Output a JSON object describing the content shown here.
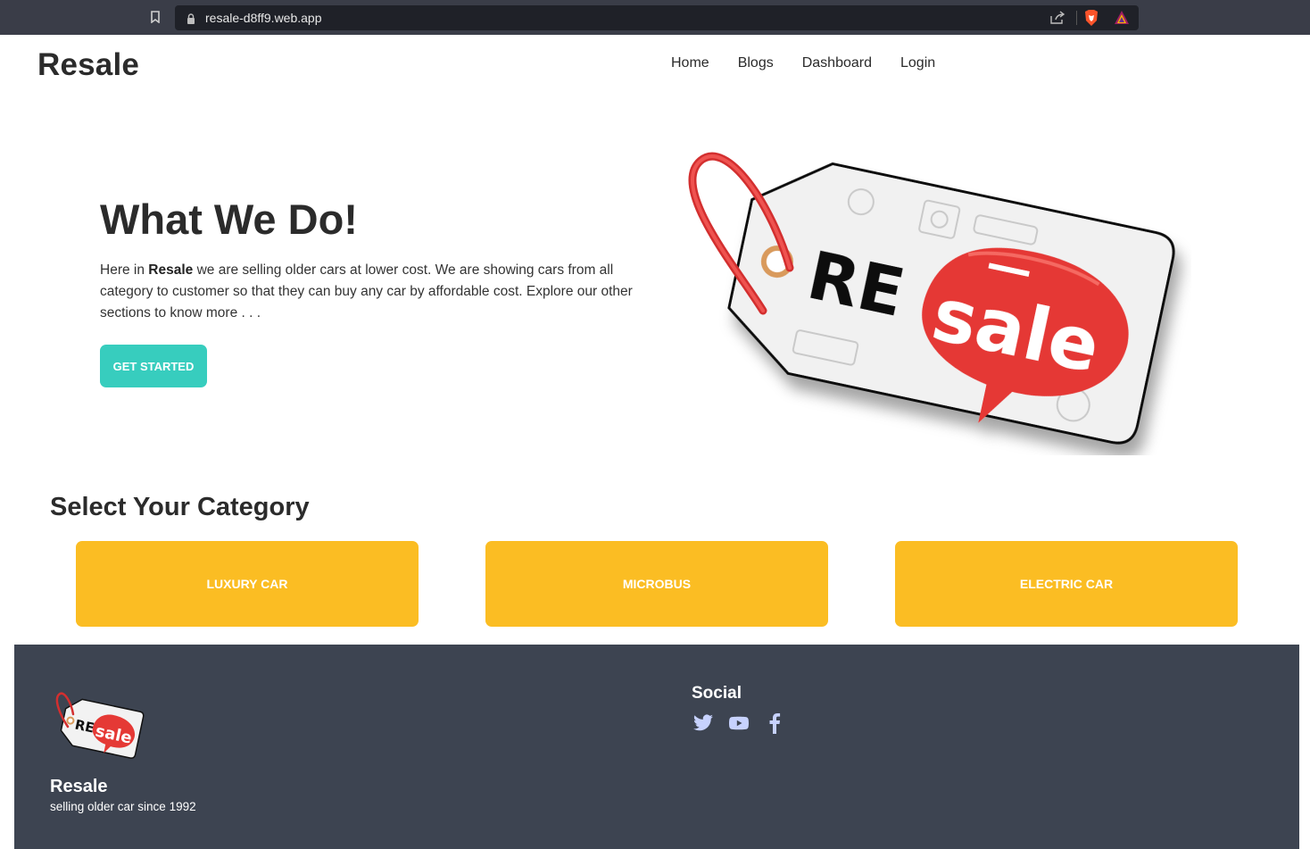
{
  "browser": {
    "url": "resale-d8ff9.web.app"
  },
  "navbar": {
    "brand": "Resale",
    "links": [
      "Home",
      "Blogs",
      "Dashboard",
      "Login"
    ]
  },
  "hero": {
    "title": "What We Do!",
    "text_before": "Here in ",
    "text_bold": "Resale",
    "text_after": " we are selling older cars at lower cost. We are showing cars from all category to customer so that they can buy any car by affordable cost. Explore our other sections to know more . . .",
    "cta_label": "GET STARTED",
    "image": {
      "icon": "resale-price-tag-logo",
      "text_re": "RE",
      "text_sale": "sale"
    }
  },
  "categories": {
    "title": "Select Your Category",
    "items": [
      "LUXURY CAR",
      "MICROBUS",
      "ELECTRIC CAR"
    ]
  },
  "footer": {
    "logo": {
      "icon": "resale-price-tag-logo",
      "text_re": "RE",
      "text_sale": "sale"
    },
    "brand": "Resale",
    "tagline": "selling older car since 1992",
    "social_title": "Social",
    "social_icons": [
      "twitter-icon",
      "youtube-icon",
      "facebook-icon"
    ]
  },
  "colors": {
    "accent_teal": "#37cdbe",
    "category_yellow": "#fbbd23",
    "footer_bg": "#3d4451",
    "tag_red": "#e53935"
  }
}
